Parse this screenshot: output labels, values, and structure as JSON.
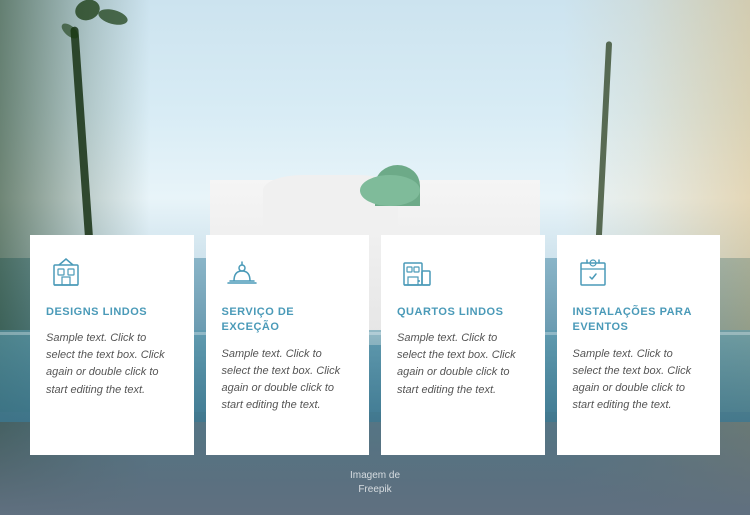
{
  "background": {
    "alt": "Hotel resort with pool background"
  },
  "cards": [
    {
      "id": "card-1",
      "icon": "building-icon",
      "title": "DESIGNS LINDOS",
      "text": "Sample text. Click to select the text box. Click again or double click to start editing the text."
    },
    {
      "id": "card-2",
      "icon": "service-icon",
      "title": "SERVIÇO DE EXCEÇÃO",
      "text": "Sample text. Click to select the text box. Click again or double click to start editing the text."
    },
    {
      "id": "card-3",
      "icon": "room-icon",
      "title": "QUARTOS LINDOS",
      "text": "Sample text. Click to select the text box. Click again or double click to start editing the text."
    },
    {
      "id": "card-4",
      "icon": "events-icon",
      "title": "INSTALAÇÕES PARA EVENTOS",
      "text": "Sample text. Click to select the text box. Click again or double click to start editing the text."
    }
  ],
  "attribution": {
    "line1": "Imagem de",
    "line2": "Freepik"
  }
}
